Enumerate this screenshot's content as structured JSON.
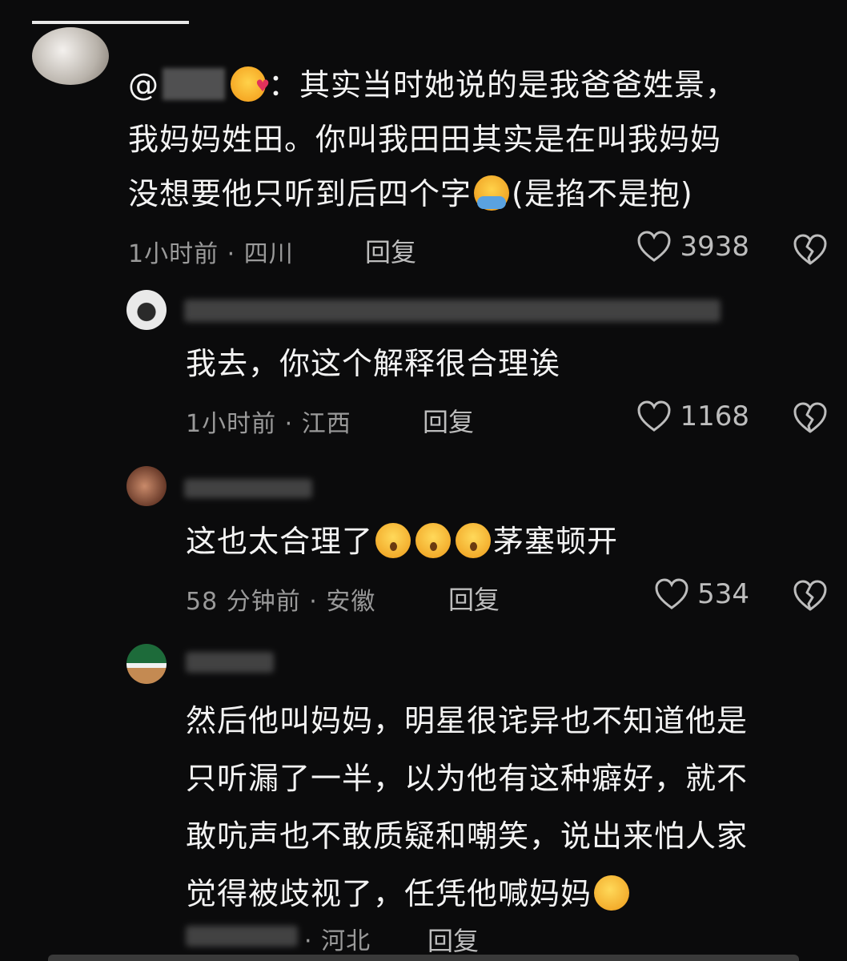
{
  "comments": [
    {
      "mention": "@",
      "text_1": "：其实当时她说的是我爸爸姓景，",
      "text_2": "我妈妈姓田。你叫我田田其实是在叫我妈妈",
      "text_3": "没想要他只听到后四个字",
      "text_3b": "(是掐不是抱)",
      "meta": "1小时前 · 四川",
      "reply": "回复",
      "likes": "3938"
    },
    {
      "text": "我去，你这个解释很合理诶",
      "meta": "1小时前 · 江西",
      "reply": "回复",
      "likes": "1168"
    },
    {
      "text_a": "这也太合理了",
      "text_b": "茅塞顿开",
      "meta": "58 分钟前 · 安徽",
      "reply": "回复",
      "likes": "534"
    },
    {
      "line_1": "然后他叫妈妈，明星很诧异也不知道他是",
      "line_2": "只听漏了一半，以为他有这种癖好，就不",
      "line_3": "敢吭声也不敢质疑和嘲笑，说出来怕人家",
      "line_4": "觉得被歧视了，任凭他喊妈妈",
      "meta": "· 河北",
      "reply": "回复"
    }
  ]
}
